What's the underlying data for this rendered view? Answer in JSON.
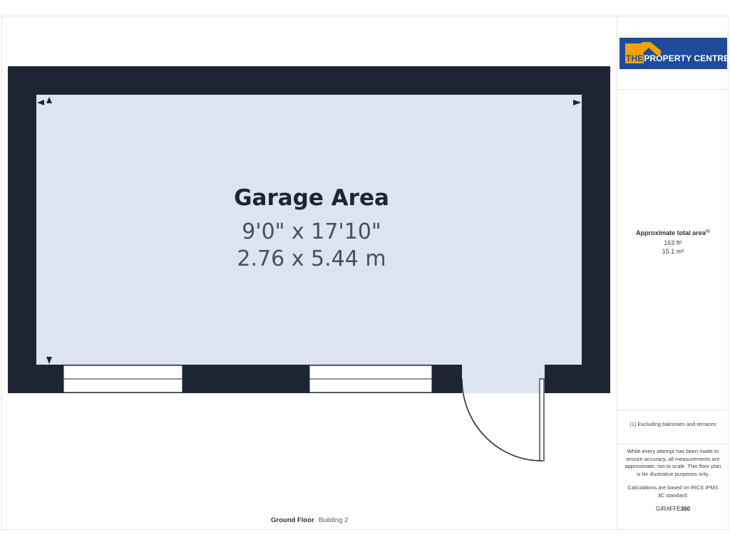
{
  "room": {
    "name": "Garage Area",
    "dim_imperial": "9'0\" x 17'10\"",
    "dim_metric": "2.76 x 5.44 m"
  },
  "footer": {
    "floor": "Ground Floor",
    "building": "Building 2"
  },
  "logo": {
    "the": "THE",
    "name": "PROPERTY CENTRE"
  },
  "area": {
    "title": "Approximate total area",
    "footnote_mark": "(1)",
    "sqft": "163 ft²",
    "sqm": "15.1 m²"
  },
  "notes": {
    "footnote": "(1) Excluding balconies and terraces",
    "disclaimer": "While every attempt has been made to ensure accuracy, all measurements are approximate, not to scale. This floor plan is for illustrative purposes only.",
    "calc": "Calculations are based on RICS IPMS 3C standard.",
    "brand_a": "GIRAFFE",
    "brand_b": "360"
  },
  "colors": {
    "wall": "#1f2433",
    "floor": "#dde3f0",
    "logo_bg": "#1f4b9b",
    "logo_accent": "#f2a20c"
  }
}
